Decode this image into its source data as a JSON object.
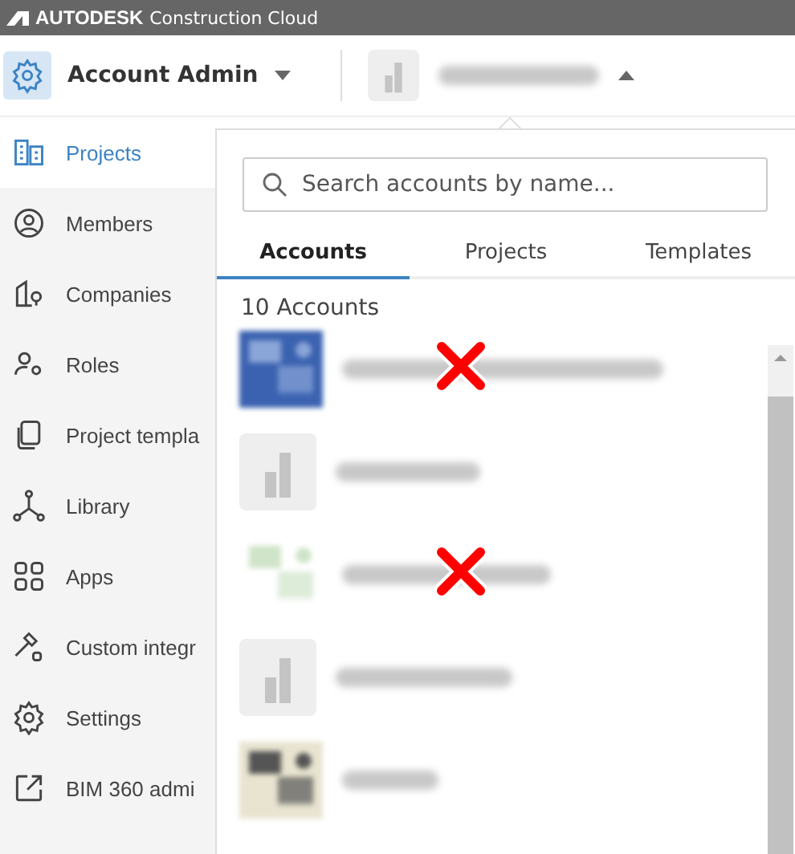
{
  "brand": {
    "name": "AUTODESK",
    "product": "Construction Cloud"
  },
  "header": {
    "module": "Account Admin",
    "module_menu_open": false,
    "account_menu_open": true
  },
  "sidebar": {
    "items": [
      {
        "label": "Projects",
        "selected": true
      },
      {
        "label": "Members",
        "selected": false
      },
      {
        "label": "Companies",
        "selected": false
      },
      {
        "label": "Roles",
        "selected": false
      },
      {
        "label": "Project templa",
        "selected": false
      },
      {
        "label": "Library",
        "selected": false
      },
      {
        "label": "Apps",
        "selected": false
      },
      {
        "label": "Custom integr",
        "selected": false
      },
      {
        "label": "Settings",
        "selected": false
      },
      {
        "label": "BIM 360 admi",
        "selected": false
      }
    ]
  },
  "account_menu": {
    "search": {
      "placeholder": "Search accounts by name..."
    },
    "tabs": [
      {
        "label": "Accounts",
        "selected": true
      },
      {
        "label": "Projects",
        "selected": false
      },
      {
        "label": "Templates",
        "selected": false
      }
    ],
    "count": "10 Accounts",
    "accounts": [
      {
        "kind": "logo",
        "marked": true
      },
      {
        "kind": "placeholder",
        "marked": false
      },
      {
        "kind": "logo",
        "marked": true
      },
      {
        "kind": "placeholder",
        "marked": false
      },
      {
        "kind": "logo",
        "marked": false
      }
    ]
  }
}
